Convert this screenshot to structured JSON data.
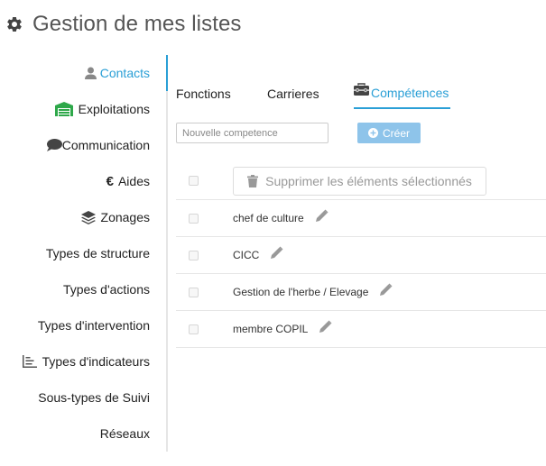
{
  "page": {
    "title": "Gestion de mes listes"
  },
  "sidebar": {
    "items": [
      {
        "label": "Contacts",
        "icon": "user-icon",
        "active": true
      },
      {
        "label": "Exploitations",
        "icon": "warehouse-icon"
      },
      {
        "label": "Communication",
        "icon": "comment-icon"
      },
      {
        "label": "Aides",
        "icon": "euro-icon"
      },
      {
        "label": "Zonages",
        "icon": "layers-icon"
      },
      {
        "label": "Types de structure"
      },
      {
        "label": "Types d'actions"
      },
      {
        "label": "Types d'intervention"
      },
      {
        "label": "Types d'indicateurs",
        "icon": "chart-icon"
      },
      {
        "label": "Sous-types de Suivi"
      },
      {
        "label": "Réseaux"
      }
    ]
  },
  "tabs": [
    {
      "label": "Fonctions"
    },
    {
      "label": "Carrieres"
    },
    {
      "label": "Compétences",
      "icon": "toolbox-icon",
      "active": true
    }
  ],
  "form": {
    "input_value": "",
    "input_placeholder": "Nouvelle competence",
    "create_label": "Créer"
  },
  "table": {
    "delete_selected_label": "Supprimer les éléments sélectionnés",
    "rows": [
      {
        "label": "chef de culture"
      },
      {
        "label": "CICC"
      },
      {
        "label": "Gestion de l'herbe / Elevage"
      },
      {
        "label": "membre COPIL"
      }
    ]
  },
  "colors": {
    "accent": "#2a9fd6",
    "create_button": "#8ec4ea",
    "exploitations_icon": "#2ea84a",
    "muted_icon": "#999999"
  }
}
